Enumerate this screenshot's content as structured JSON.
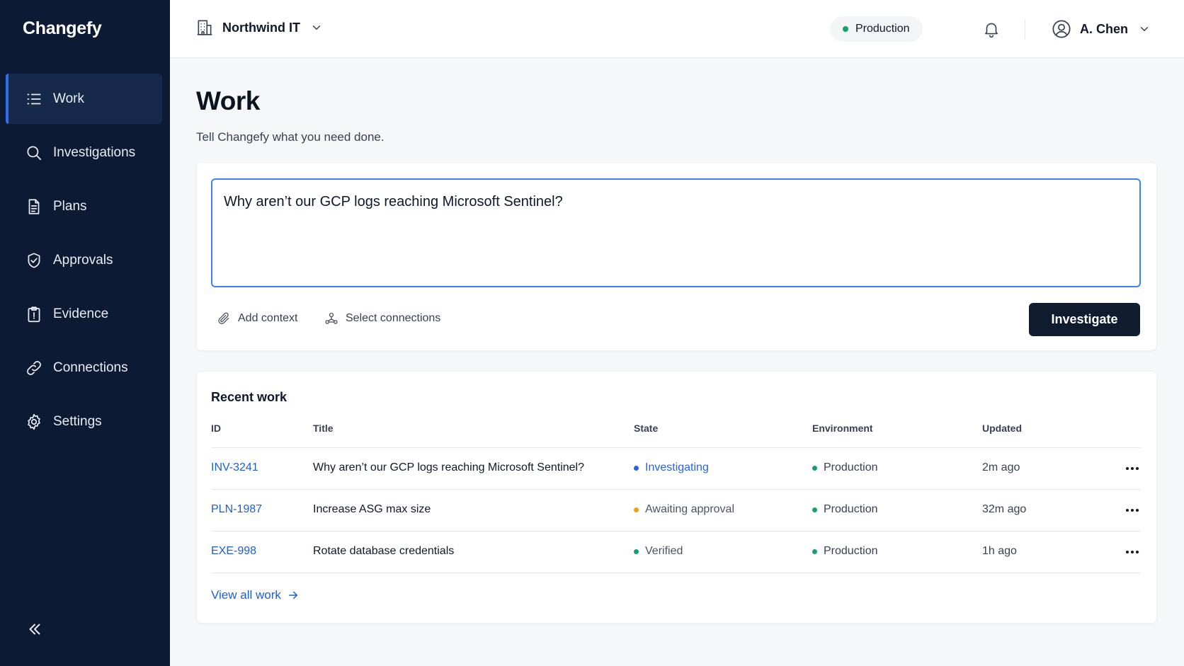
{
  "app": {
    "brand": "Changefy"
  },
  "colors": {
    "accent": "#2f6fed",
    "sidebar_bg": "#0c1a33",
    "link": "#1d5fd3",
    "green": "#10a36b",
    "blue": "#2563eb",
    "orange": "#f59e0b"
  },
  "sidebar": {
    "items": [
      {
        "label": "Work",
        "icon": "list-icon",
        "active": true
      },
      {
        "label": "Investigations",
        "icon": "search-icon"
      },
      {
        "label": "Plans",
        "icon": "document-icon"
      },
      {
        "label": "Approvals",
        "icon": "shield-check-icon"
      },
      {
        "label": "Evidence",
        "icon": "clipboard-icon"
      },
      {
        "label": "Connections",
        "icon": "link-icon"
      },
      {
        "label": "Settings",
        "icon": "gear-icon"
      }
    ],
    "collapse_icon": "double-chevron-left-icon"
  },
  "topbar": {
    "org": "Northwind IT",
    "environment": "Production",
    "user": "A. Chen"
  },
  "main": {
    "title": "Work",
    "subtitle": "Tell Changefy what you need done.",
    "prompt": {
      "value": "Why aren’t our GCP logs reaching Microsoft Sentinel?",
      "add_context": "Add context",
      "select_connections": "Select connections",
      "submit": "Investigate"
    },
    "recent": {
      "title": "Recent work",
      "columns": [
        "ID",
        "Title",
        "State",
        "Environment",
        "Updated"
      ],
      "rows": [
        {
          "id": "INV-3241",
          "title": "Why aren’t our GCP logs reaching Microsoft Sentinel?",
          "state": "Investigating",
          "state_color": "#2563eb",
          "environment": "Production",
          "updated": "2m ago"
        },
        {
          "id": "PLN-1987",
          "title": "Increase ASG max size",
          "state": "Awaiting approval",
          "state_color": "#f59e0b",
          "environment": "Production",
          "updated": "32m ago"
        },
        {
          "id": "EXE-998",
          "title": "Rotate database credentials",
          "state": "Verified",
          "state_color": "#10a36b",
          "environment": "Production",
          "updated": "1h ago"
        }
      ],
      "view_all": "View all work"
    }
  }
}
